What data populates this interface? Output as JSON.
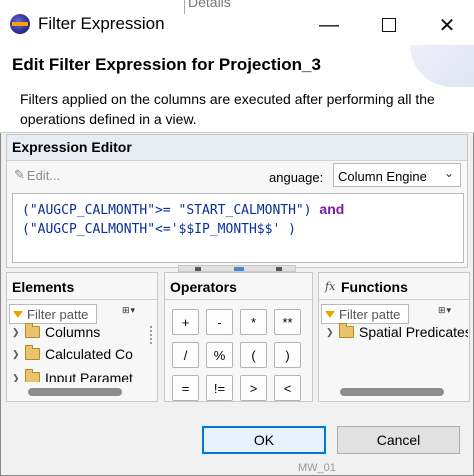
{
  "window": {
    "title": "Filter Expression",
    "background_fragment": "Details",
    "controls": [
      "minimize",
      "maximize",
      "close"
    ]
  },
  "header": {
    "title": "Edit Filter Expression for Projection_3",
    "description": "Filters applied on the columns are executed after performing all the operations defined in a view."
  },
  "expression_editor": {
    "title": "Expression Editor",
    "edit_label": "Edit...",
    "language_label": "anguage:",
    "language_value": "Column Engine",
    "expression_line1_code": "(\"AUGCP_CALMONTH\">= \"START_CALMONTH\")",
    "expression_line1_keyword": "and",
    "expression_line2_code": "(\"AUGCP_CALMONTH\"<='$$IP_MONTH$$' )"
  },
  "elements": {
    "title": "Elements",
    "filter_placeholder": "Filter patte",
    "tree": [
      "Columns",
      "Calculated Co",
      "Input Paramet"
    ]
  },
  "operators": {
    "title": "Operators",
    "buttons": [
      "+",
      "-",
      "*",
      "**",
      "/",
      "%",
      "(",
      ")",
      "=",
      "!=",
      ">",
      "<"
    ]
  },
  "functions": {
    "title": "Functions",
    "filter_placeholder": "Filter patte",
    "tree": [
      "Spatial Predicates"
    ]
  },
  "footer": {
    "ok_label": "OK",
    "cancel_label": "Cancel",
    "background_fragment": "MW_01"
  },
  "colors": {
    "accent": "#0078d7",
    "keyword": "#7a1aa6",
    "string": "#0a2f98",
    "panel_header": "#e8ecf3"
  },
  "icons": {
    "app": "eclipse-icon",
    "edit": "pencil-icon",
    "filter": "funnel-icon",
    "folder": "folder-icon",
    "functions": "fx-icon"
  }
}
